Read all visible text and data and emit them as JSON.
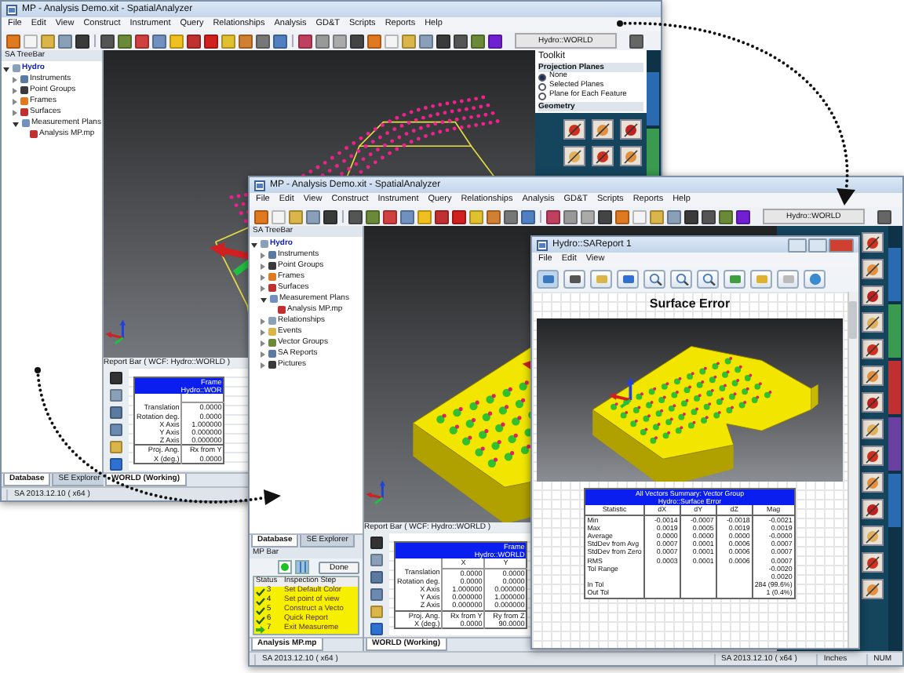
{
  "windows": [
    {
      "kind": "app",
      "title": "MP - Analysis Demo.xit - SpatialAnalyzer",
      "menu": [
        "File",
        "Edit",
        "View",
        "Construct",
        "Instrument",
        "Query",
        "Relationships",
        "Analysis",
        "GD&T",
        "Scripts",
        "Reports",
        "Help"
      ],
      "frame_field": "Hydro::WORLD",
      "treebar": {
        "title": "SA TreeBar",
        "items": [
          {
            "label": "Hydro",
            "expanded": true,
            "children": [
              {
                "label": "Instruments",
                "expanded": false
              },
              {
                "label": "Point Groups",
                "expanded": false
              },
              {
                "label": "Frames",
                "expanded": false
              },
              {
                "label": "Surfaces",
                "expanded": false
              },
              {
                "label": "Measurement Plans",
                "expanded": true,
                "children": [
                  {
                    "label": "Analysis MP.mp"
                  }
                ]
              }
            ]
          }
        ]
      },
      "viewport": {
        "kind": "wireframe"
      },
      "side_tabs": [
        {
          "label": "Database",
          "selected": true
        },
        {
          "label": "SE Explorer",
          "selected": false
        }
      ],
      "report_bar": {
        "title": "Report Bar ( WCF: Hydro::WORLD )",
        "table": {
          "title": "Frame",
          "subtitle": "Hydro::WOR",
          "rows": [
            [
              "Translation",
              "0.0000"
            ],
            [
              "Rotation deg.",
              "0.0000"
            ],
            [
              "X Axis",
              "1.000000"
            ],
            [
              "Y Axis",
              "0.000000"
            ],
            [
              "Z Axis",
              "0.000000"
            ],
            [
              "Proj. Ang.",
              "Rx from Y"
            ],
            [
              "X (deg.)",
              "0.0000"
            ]
          ]
        }
      },
      "view_tabs": [
        {
          "label": "WORLD (Working)",
          "selected": true
        }
      ],
      "toolkit": {
        "title": "Toolkit",
        "sections": [
          {
            "title": "Projection Planes",
            "options": [
              {
                "label": "None",
                "selected": true
              },
              {
                "label": "Selected Planes",
                "selected": false
              },
              {
                "label": "Plane for Each Feature",
                "selected": false
              }
            ]
          },
          {
            "title": "Geometry"
          }
        ]
      },
      "status_bar": [
        "SA 2013.12.10 ( x64 )"
      ]
    },
    {
      "kind": "app",
      "title": "MP - Analysis Demo.xit - SpatialAnalyzer",
      "menu": [
        "File",
        "Edit",
        "View",
        "Construct",
        "Instrument",
        "Query",
        "Relationships",
        "Analysis",
        "GD&T",
        "Scripts",
        "Reports",
        "Help"
      ],
      "frame_field": "Hydro::WORLD",
      "treebar": {
        "title": "SA TreeBar",
        "items": [
          {
            "label": "Hydro",
            "expanded": true,
            "children": [
              {
                "label": "Instruments",
                "expanded": false
              },
              {
                "label": "Point Groups",
                "expanded": false
              },
              {
                "label": "Frames",
                "expanded": false
              },
              {
                "label": "Surfaces",
                "expanded": false
              },
              {
                "label": "Measurement Plans",
                "expanded": true,
                "children": [
                  {
                    "label": "Analysis MP.mp"
                  }
                ]
              },
              {
                "label": "Relationships",
                "expanded": false
              },
              {
                "label": "Events",
                "expanded": false
              },
              {
                "label": "Vector Groups",
                "expanded": false
              },
              {
                "label": "SA Reports",
                "expanded": false
              },
              {
                "label": "Pictures",
                "expanded": false
              }
            ]
          }
        ]
      },
      "viewport": {
        "kind": "solid"
      },
      "side_tabs": [
        {
          "label": "Database",
          "selected": true
        },
        {
          "label": "SE Explorer",
          "selected": false
        }
      ],
      "mp_bar": {
        "title": "MP Bar",
        "button": "Done",
        "columns": [
          "Status",
          "Inspection Step"
        ],
        "steps": [
          {
            "kind": "done",
            "number": "3",
            "label": "Set Default Color"
          },
          {
            "kind": "done",
            "number": "4",
            "label": "Set point of view"
          },
          {
            "kind": "done",
            "number": "5",
            "label": "Construct a Vecto"
          },
          {
            "kind": "done",
            "number": "6",
            "label": "Quick Report"
          },
          {
            "kind": "current",
            "number": "7",
            "label": "Exit Measureme"
          }
        ]
      },
      "mp_tabs": [
        {
          "label": "Analysis MP.mp",
          "selected": true
        }
      ],
      "report_bar": {
        "title": "Report Bar ( WCF: Hydro::WORLD )",
        "table": {
          "title": "Frame",
          "subtitle": "Hydro::WORLD",
          "columns": [
            "",
            "X",
            "Y"
          ],
          "rows": [
            [
              "Translation",
              "0.0000",
              "0.0000"
            ],
            [
              "Rotation deg.",
              "0.0000",
              "0.0000"
            ],
            [
              "X Axis",
              "1.000000",
              "0.000000"
            ],
            [
              "Y Axis",
              "0.000000",
              "1.000000"
            ],
            [
              "Z Axis",
              "0.000000",
              "0.000000"
            ],
            [
              "Proj. Ang.",
              "Rx from Y",
              "Ry from Z"
            ],
            [
              "X (deg.)",
              "0.0000",
              "90.0000"
            ]
          ]
        }
      },
      "view_tabs": [
        {
          "label": "WORLD (Working)",
          "selected": true
        }
      ],
      "status_bar": [
        "SA 2013.12.10 ( x64 )",
        "SA 2013.12.10 ( x64 )",
        "Inches",
        "NUM"
      ]
    },
    {
      "kind": "report",
      "title": "Hydro::SAReport 1",
      "menu": [
        "File",
        "Edit",
        "View"
      ],
      "heading": "Surface Error",
      "summary": {
        "title": "All Vectors Summary: Vector Group",
        "subtitle": "Hydro::Surface Error",
        "columns": [
          "Statistic",
          "dX",
          "dY",
          "dZ",
          "Mag"
        ],
        "rows": [
          [
            "Min",
            "-0.0014",
            "-0.0007",
            "-0.0018",
            "-0.0021"
          ],
          [
            "Max",
            "0.0019",
            "0.0005",
            "0.0019",
            "0.0019"
          ],
          [
            "Average",
            "0.0000",
            "0.0000",
            "0.0000",
            "-0.0000"
          ],
          [
            "StdDev from Avg",
            "0.0007",
            "0.0001",
            "0.0006",
            "0.0007"
          ],
          [
            "StdDev from Zero",
            "0.0007",
            "0.0001",
            "0.0006",
            "0.0007"
          ],
          [
            "RMS",
            "0.0003",
            "0.0001",
            "0.0006",
            "0.0007"
          ],
          [
            "Tol Range",
            null,
            null,
            null,
            "-0.0020"
          ],
          [
            null,
            null,
            null,
            null,
            "0.0020"
          ],
          [
            "In Tol",
            null,
            null,
            null,
            "284 (99.6%)"
          ],
          [
            "Out Tol",
            null,
            null,
            null,
            "1 (0.4%)"
          ]
        ]
      }
    }
  ]
}
